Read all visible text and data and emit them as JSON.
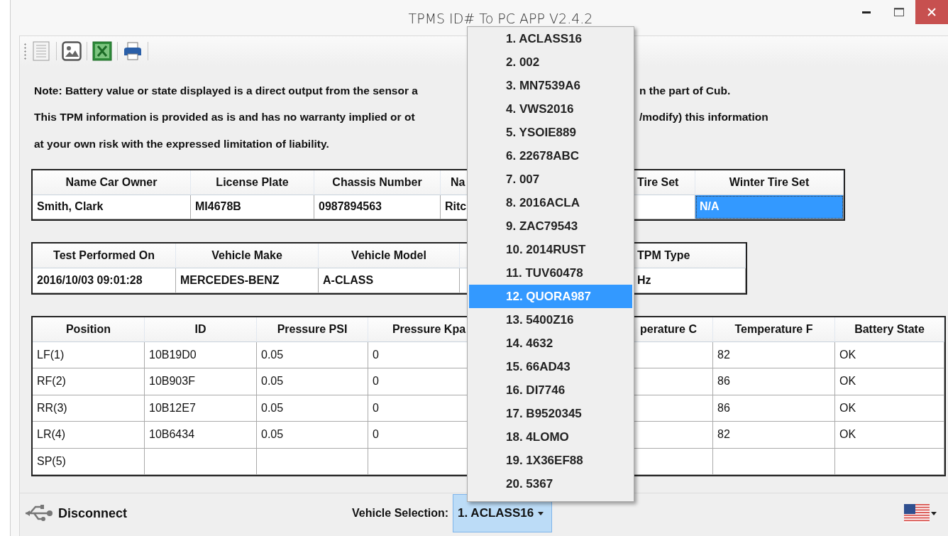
{
  "window": {
    "title": "TPMS ID# To PC APP V2.4.2"
  },
  "note_lines": [
    {
      "before": "Note: Battery value or state displayed is a direct output from the sensor a",
      "after": "n the part of Cub."
    },
    {
      "before": "This TPM information is provided as is and has no warranty implied or ot",
      "after": "/modify) this information"
    },
    {
      "before": "at your own risk with the expressed limitation of liability."
    }
  ],
  "owner_table": {
    "columns": [
      "Name Car Owner",
      "License Plate",
      "Chassis Number",
      "Na",
      "Tire Set",
      "Winter Tire Set"
    ],
    "cells": [
      {
        "text": "Smith, Clark",
        "selected": false
      },
      {
        "text": "MI4678B",
        "selected": false
      },
      {
        "text": "0987894563",
        "selected": false
      },
      {
        "text": "Ritc",
        "selected": false
      },
      {
        "selected": false
      },
      {
        "text": "N/A",
        "selected": true
      }
    ]
  },
  "vehicle_table": {
    "columns": [
      "Test Performed On",
      "Vehicle Make",
      "Vehicle Model",
      "TPM Type"
    ],
    "cells": [
      "2016/10/03   09:01:28",
      "MERCEDES-BENZ",
      "A-CLASS",
      "Hz"
    ]
  },
  "sensor_table": {
    "columns": [
      "Position",
      "ID",
      "Pressure PSI",
      "Pressure Kpa",
      "perature C",
      "Temperature F",
      "Battery State"
    ],
    "rows": [
      [
        "LF(1)",
        "10B19D0",
        "0.05",
        "0",
        "82",
        "OK"
      ],
      [
        "RF(2)",
        "10B903F",
        "0.05",
        "0",
        "86",
        "OK"
      ],
      [
        "RR(3)",
        "10B12E7",
        "0.05",
        "0",
        "86",
        "OK"
      ],
      [
        "LR(4)",
        "10B6434",
        "0.05",
        "0",
        "82",
        "OK"
      ],
      [
        "SP(5)"
      ]
    ]
  },
  "status_bar": {
    "connection": "Disconnect",
    "vehicle_label": "Vehicle Selection:",
    "vehicle_combo": {
      "value": "1. ACLASS16",
      "expanded": true
    }
  },
  "vehicle_dropdown": [
    {
      "label": "1. ACLASS16",
      "selected": false
    },
    {
      "label": "2. 002",
      "selected": false
    },
    {
      "label": "3. MN7539A6",
      "selected": false
    },
    {
      "label": "4. VWS2016",
      "selected": false
    },
    {
      "label": "5. YSOIE889",
      "selected": false
    },
    {
      "label": "6. 22678ABC",
      "selected": false
    },
    {
      "label": "7. 007",
      "selected": false
    },
    {
      "label": "8. 2016ACLA",
      "selected": false
    },
    {
      "label": "9. ZAC79543",
      "selected": false
    },
    {
      "label": "10. 2014RUST",
      "selected": false
    },
    {
      "label": "11. TUV60478",
      "selected": false
    },
    {
      "label": "12. QUORA987",
      "selected": true
    },
    {
      "label": "13. 5400Z16",
      "selected": false
    },
    {
      "label": "14. 4632",
      "selected": false
    },
    {
      "label": "15. 66AD43",
      "selected": false
    },
    {
      "label": "16. DI7746",
      "selected": false
    },
    {
      "label": "17. B9520345",
      "selected": false
    },
    {
      "label": "18. 4LOMO",
      "selected": false
    },
    {
      "label": "19. 1X36EF88",
      "selected": false
    },
    {
      "label": "20. 5367",
      "selected": false
    }
  ]
}
